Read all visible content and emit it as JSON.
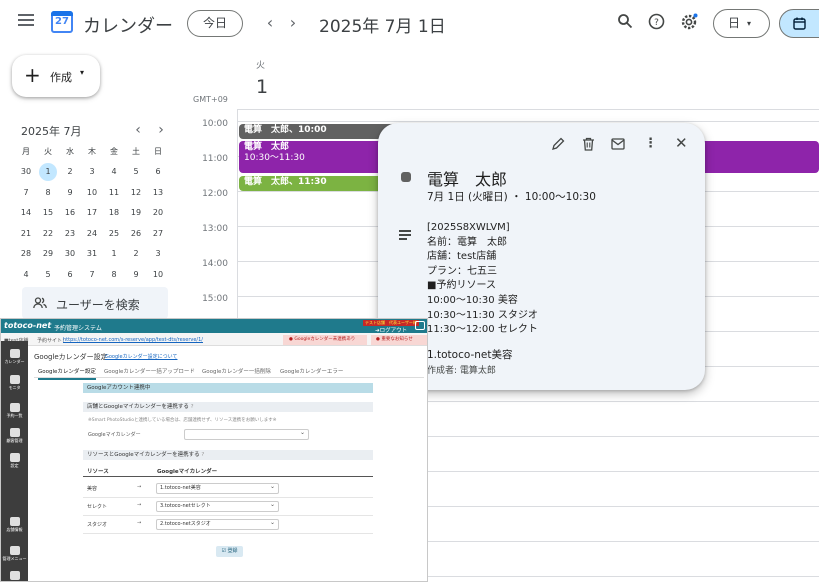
{
  "header": {
    "app_name": "カレンダー",
    "logo_day": "27",
    "today_button": "今日",
    "current_date": "2025年 7月 1日",
    "view_selector": "日"
  },
  "sidebar": {
    "create_label": "作成",
    "mini_calendar": {
      "title": "2025年 7月",
      "weekdays": [
        "月",
        "火",
        "水",
        "木",
        "金",
        "土",
        "日"
      ],
      "weeks": [
        [
          "30",
          "1",
          "2",
          "3",
          "4",
          "5",
          "6"
        ],
        [
          "7",
          "8",
          "9",
          "10",
          "11",
          "12",
          "13"
        ],
        [
          "14",
          "15",
          "16",
          "17",
          "18",
          "19",
          "20"
        ],
        [
          "21",
          "22",
          "23",
          "24",
          "25",
          "26",
          "27"
        ],
        [
          "28",
          "29",
          "30",
          "31",
          "1",
          "2",
          "3"
        ],
        [
          "4",
          "5",
          "6",
          "7",
          "8",
          "9",
          "10"
        ]
      ],
      "today": "1"
    },
    "user_search": "ユーザーを検索"
  },
  "day_view": {
    "weekday": "火",
    "day_number": "1",
    "timezone": "GMT+09",
    "hours": [
      "10:00",
      "11:00",
      "12:00",
      "13:00",
      "14:00",
      "15:00"
    ],
    "events": [
      {
        "label": "電算　太郎、10:00",
        "color": "#616161"
      },
      {
        "label": "電算　太郎",
        "time": "10:30～11:30",
        "color": "#8e24aa"
      },
      {
        "label": "電算　太郎、11:30",
        "color": "#7cb342"
      }
    ]
  },
  "popup": {
    "title": "電算　太郎",
    "datetime": "7月 1日 (火曜日) ・ 10:00～10:30",
    "description": "[2025S8XWLVM]\n名前：電算　太郎\n店舗：test店舗\nプラン：七五三\n■予約リソース\n10:00～10:30 美容\n10:30～11:30 スタジオ\n11:30～12:00 セレクト",
    "calendar": "1.totoco-net美容",
    "creator": "作成者: 電算太郎",
    "color": "#616161"
  },
  "embed": {
    "brand": "totoco-net",
    "system_name": "予約管理システム",
    "test_badge": "テスト店舗　代表ユーザー様",
    "logout": "ログアウト",
    "store": "test店舗",
    "site_label": "予約サイト：",
    "site_url": "https://totoco-net.com/s-reserve/app/test-dts/reserve/1/",
    "alert_unlinked": "Googleカレンダー未連携あり",
    "alert_notice": "重要なお知らせ",
    "side_items": [
      "カレンダー",
      "モニタ",
      "予約一覧",
      "顧客管理",
      "設定",
      "店舗情報",
      "管理メニュー",
      "ヘルプ"
    ],
    "page_title": "Googleカレンダー設定",
    "page_link": "Googleカレンダー設定について",
    "tabs": [
      "Googleカレンダー設定",
      "Googleカレンダー一括アップロード",
      "Googleカレンダー一括削除",
      "Googleカレンダーエラー"
    ],
    "linked_banner": "Googleアカウント連携中",
    "section1_title": "店舗とGoogleマイカレンダーを連携する",
    "section1_note": "※Smart PhotoStudioと連携している場合は、店舗連携せず、リソース連携をお願いします※",
    "section1_field": "Googleマイカレンダー",
    "section2_title": "リソースとGoogleマイカレンダーを連携する",
    "col_resource": "リソース",
    "col_calendar": "Googleマイカレンダー",
    "rows": [
      {
        "resource": "美容",
        "calendar": "1.totoco-net美容"
      },
      {
        "resource": "セレクト",
        "calendar": "3.totoco-netセレクト"
      },
      {
        "resource": "スタジオ",
        "calendar": "2.totoco-netスタジオ"
      }
    ],
    "save_button": "登録"
  }
}
